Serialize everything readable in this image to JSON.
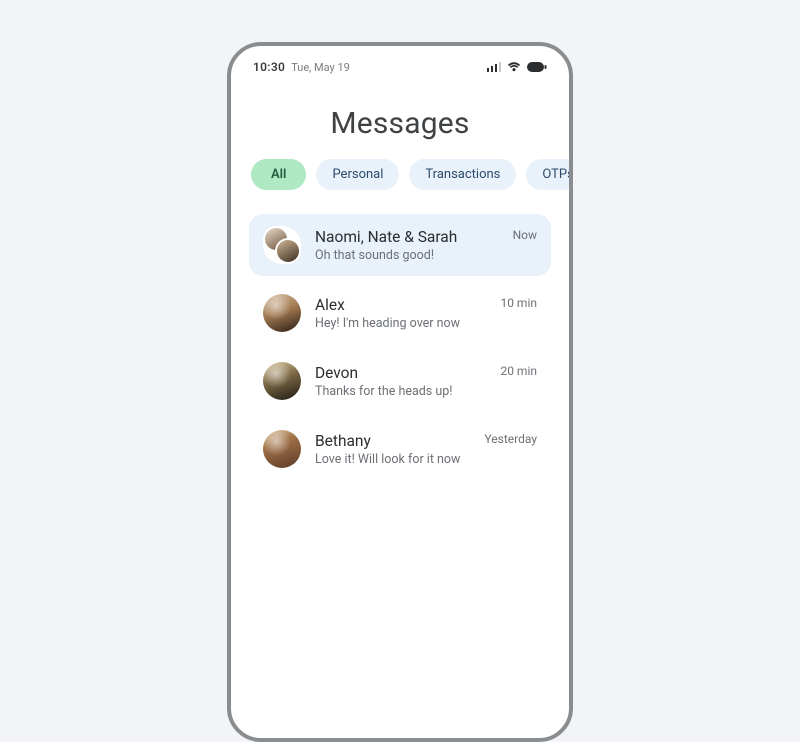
{
  "statusbar": {
    "time": "10:30",
    "date": "Tue, May 19"
  },
  "title": "Messages",
  "chips": [
    {
      "label": "All",
      "active": true
    },
    {
      "label": "Personal",
      "active": false
    },
    {
      "label": "Transactions",
      "active": false
    },
    {
      "label": "OTPs",
      "active": false
    }
  ],
  "conversations": [
    {
      "name": "Naomi, Nate & Sarah",
      "preview": "Oh that sounds good!",
      "time": "Now",
      "highlight": true,
      "group": true
    },
    {
      "name": "Alex",
      "preview": "Hey! I'm heading over now",
      "time": "10 min",
      "highlight": false,
      "group": false
    },
    {
      "name": "Devon",
      "preview": "Thanks for the heads up!",
      "time": "20 min",
      "highlight": false,
      "group": false
    },
    {
      "name": "Bethany",
      "preview": "Love it! Will look for it now",
      "time": "Yesterday",
      "highlight": false,
      "group": false
    }
  ]
}
